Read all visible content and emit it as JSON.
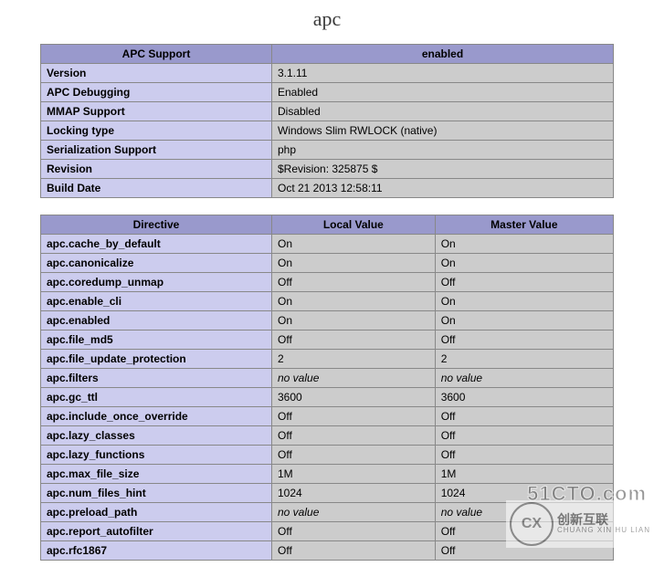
{
  "module_name": "apc",
  "info_table": {
    "headers": [
      "APC Support",
      "enabled"
    ],
    "rows": [
      {
        "key": "Version",
        "value": "3.1.11"
      },
      {
        "key": "APC Debugging",
        "value": "Enabled"
      },
      {
        "key": "MMAP Support",
        "value": "Disabled"
      },
      {
        "key": "Locking type",
        "value": "Windows Slim RWLOCK (native)"
      },
      {
        "key": "Serialization Support",
        "value": "php"
      },
      {
        "key": "Revision",
        "value": "$Revision: 325875 $"
      },
      {
        "key": "Build Date",
        "value": "Oct 21 2013 12:58:11"
      }
    ]
  },
  "directives_table": {
    "headers": [
      "Directive",
      "Local Value",
      "Master Value"
    ],
    "rows": [
      {
        "directive": "apc.cache_by_default",
        "local": "On",
        "master": "On"
      },
      {
        "directive": "apc.canonicalize",
        "local": "On",
        "master": "On"
      },
      {
        "directive": "apc.coredump_unmap",
        "local": "Off",
        "master": "Off"
      },
      {
        "directive": "apc.enable_cli",
        "local": "On",
        "master": "On"
      },
      {
        "directive": "apc.enabled",
        "local": "On",
        "master": "On"
      },
      {
        "directive": "apc.file_md5",
        "local": "Off",
        "master": "Off"
      },
      {
        "directive": "apc.file_update_protection",
        "local": "2",
        "master": "2"
      },
      {
        "directive": "apc.filters",
        "local": "no value",
        "master": "no value",
        "novalue": true
      },
      {
        "directive": "apc.gc_ttl",
        "local": "3600",
        "master": "3600"
      },
      {
        "directive": "apc.include_once_override",
        "local": "Off",
        "master": "Off"
      },
      {
        "directive": "apc.lazy_classes",
        "local": "Off",
        "master": "Off"
      },
      {
        "directive": "apc.lazy_functions",
        "local": "Off",
        "master": "Off"
      },
      {
        "directive": "apc.max_file_size",
        "local": "1M",
        "master": "1M"
      },
      {
        "directive": "apc.num_files_hint",
        "local": "1024",
        "master": "1024"
      },
      {
        "directive": "apc.preload_path",
        "local": "no value",
        "master": "no value",
        "novalue": true
      },
      {
        "directive": "apc.report_autofilter",
        "local": "Off",
        "master": "Off"
      },
      {
        "directive": "apc.rfc1867",
        "local": "Off",
        "master": "Off"
      }
    ]
  },
  "watermark": {
    "site": "51CTO.com",
    "logo_letters": "CX",
    "logo_text_big": "创新互联",
    "logo_text_small": "CHUANG XIN HU LIAN"
  }
}
